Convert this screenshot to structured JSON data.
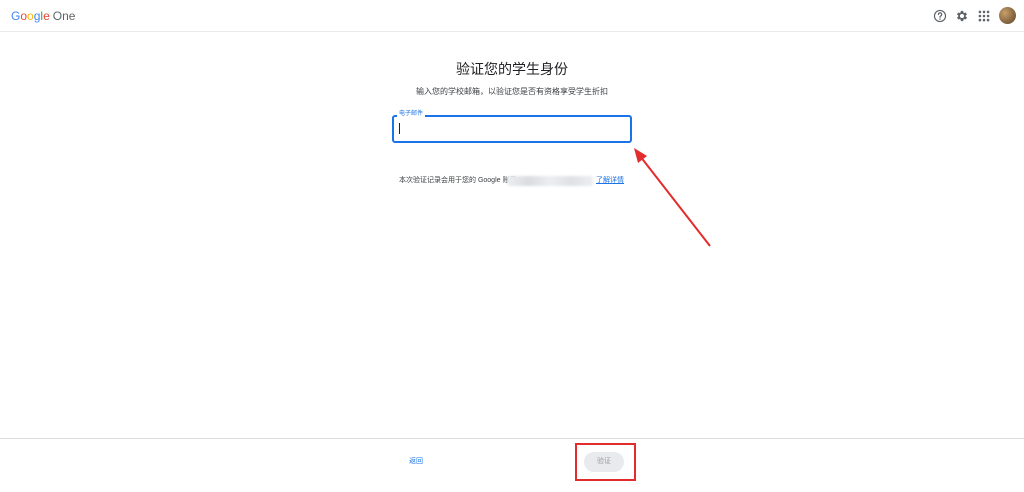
{
  "header": {
    "logo": {
      "g1": "G",
      "g2": "o",
      "g3": "o",
      "g4": "g",
      "g5": "l",
      "g6": "e",
      "product": "One"
    },
    "icons": [
      "help-icon",
      "settings-icon",
      "apps-icon"
    ]
  },
  "main": {
    "title": "验证您的学生身份",
    "subtitle": "输入您的学校邮箱，以验证您是否有资格享受学生折扣",
    "email_field": {
      "label": "电子邮件",
      "value": "",
      "placeholder": ""
    },
    "note": "本次验证记录会用于您的 Google 账号",
    "learn_more": "了解详情"
  },
  "footer": {
    "back_label": "返回",
    "verify_label": "验证"
  },
  "colors": {
    "accent": "#1a73e8",
    "annotation": "#e32c2c",
    "disabled_bg": "#e8eaed",
    "disabled_text": "#9aa0a6"
  }
}
